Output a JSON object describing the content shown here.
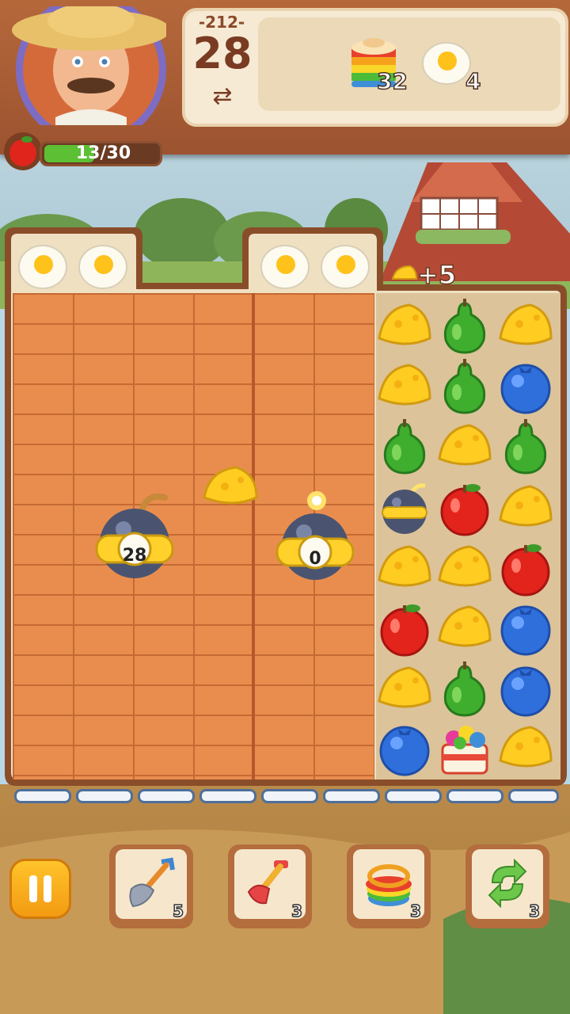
{
  "header": {
    "level_label": "-212-",
    "moves": "28",
    "swap_symbol": "⇄",
    "goals": [
      {
        "icon": "rainbow-cake-icon",
        "count": "32"
      },
      {
        "icon": "fried-egg-icon",
        "count": "4"
      }
    ],
    "progress": {
      "text": "13/30",
      "current": 13,
      "max": 30
    }
  },
  "board": {
    "top_eggs": [
      "fried-egg-icon",
      "fried-egg-icon",
      "fried-egg-icon",
      "fried-egg-icon"
    ],
    "bonus_label": "+5",
    "bombs": [
      {
        "timer": "28"
      },
      {
        "timer": "0"
      }
    ],
    "grid": [
      [
        "cheese",
        "pear",
        "cheese"
      ],
      [
        "cheese",
        "pear",
        "blueberry"
      ],
      [
        "pear",
        "cheese",
        "pear"
      ],
      [
        "bomb",
        "apple",
        "cheese"
      ],
      [
        "cheese",
        "cheese",
        "apple"
      ],
      [
        "apple",
        "cheese",
        "blueberry"
      ],
      [
        "cheese",
        "pear",
        "blueberry"
      ],
      [
        "blueberry",
        "gift-box",
        "cheese"
      ]
    ]
  },
  "boosters": [
    {
      "icon": "shovel-icon",
      "count": "5"
    },
    {
      "icon": "pitchfork-icon",
      "count": "3"
    },
    {
      "icon": "rainbow-cake-icon",
      "count": "3"
    },
    {
      "icon": "shuffle-icon",
      "count": "3"
    }
  ],
  "colors": {
    "wall": "#e98d4f",
    "header": "#b5683a",
    "pause": "#ffc42b"
  }
}
